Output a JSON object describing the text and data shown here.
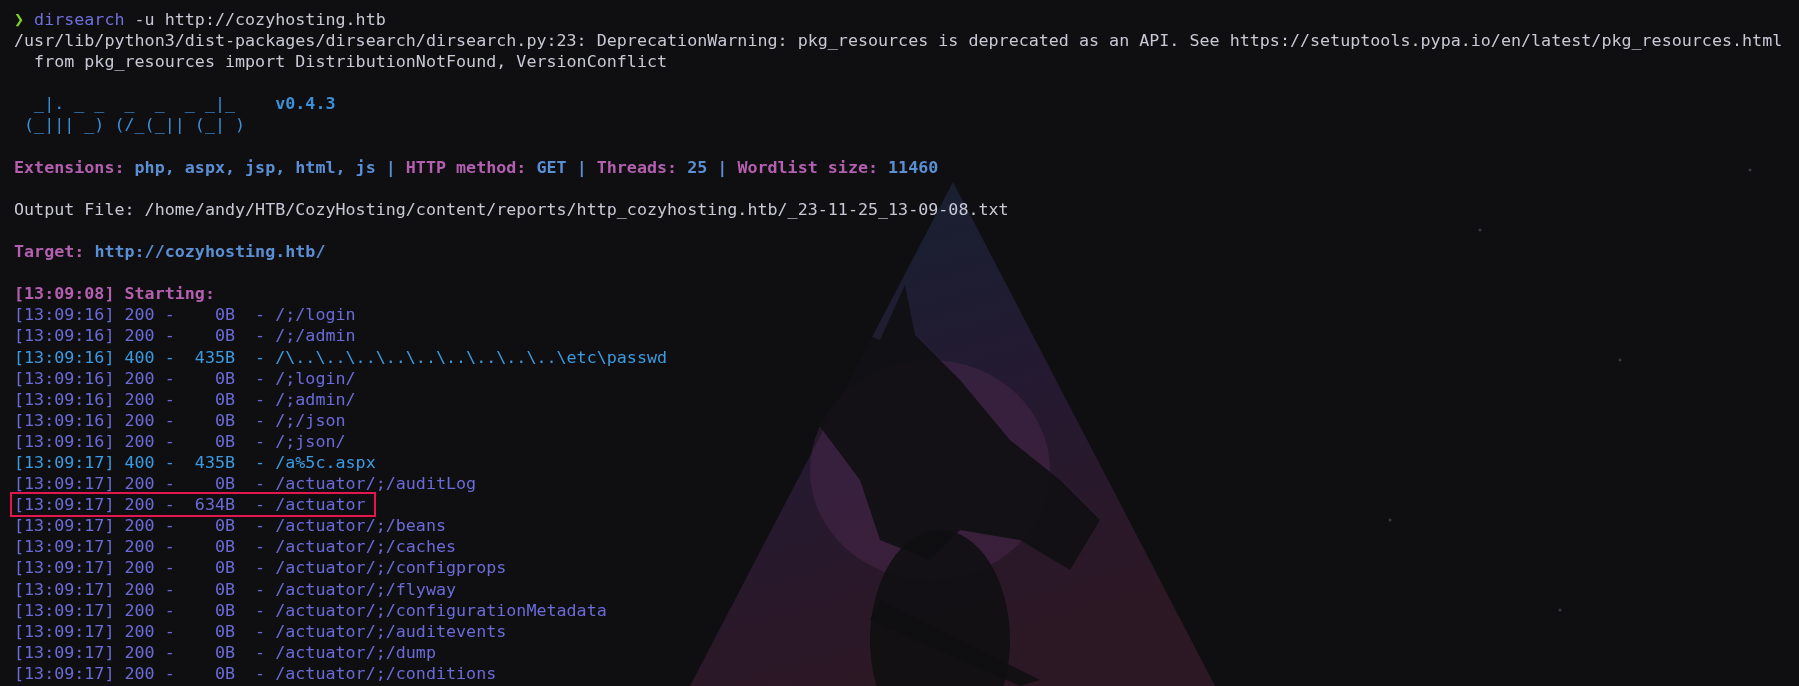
{
  "prompt": {
    "symbol": "❯",
    "command": "dirsearch",
    "arguments": "-u http://cozyhosting.htb"
  },
  "warning": [
    "/usr/lib/python3/dist-packages/dirsearch/dirsearch.py:23: DeprecationWarning: pkg_resources is deprecated as an API. See https://setuptools.pypa.io/en/latest/pkg_resources.html",
    "  from pkg_resources import DistributionNotFound, VersionConflict"
  ],
  "banner": {
    "art": [
      "  _|. _ _  _  _  _ _|_",
      " (_||| _) (/_(_|| (_| )"
    ],
    "version": "v0.4.3"
  },
  "settings": [
    {
      "label": "Extensions:",
      "value": "php, aspx, jsp, html, js",
      "separator": "|"
    },
    {
      "label": "HTTP method:",
      "value": "GET",
      "separator": "|"
    },
    {
      "label": "Threads:",
      "value": "25",
      "separator": "|"
    },
    {
      "label": "Wordlist size:",
      "value": "11460"
    }
  ],
  "output_file": "Output File: /home/andy/HTB/CozyHosting/content/reports/http_cozyhosting.htb/_23-11-25_13-09-08.txt",
  "target": {
    "label": "Target:",
    "value": "http://cozyhosting.htb/"
  },
  "start": "[13:09:08] Starting:",
  "results": [
    {
      "text": "[13:09:16] 200 -    0B  - /;/login",
      "color": "#6b6bd8",
      "highlighted": false
    },
    {
      "text": "[13:09:16] 200 -    0B  - /;/admin",
      "color": "#6b6bd8",
      "highlighted": false
    },
    {
      "text": "[13:09:16] 400 -  435B  - /\\..\\..\\..\\..\\..\\..\\..\\..\\..\\etc\\passwd",
      "color": "#3b9be0",
      "highlighted": false
    },
    {
      "text": "[13:09:16] 200 -    0B  - /;login/",
      "color": "#6b6bd8",
      "highlighted": false
    },
    {
      "text": "[13:09:16] 200 -    0B  - /;admin/",
      "color": "#6b6bd8",
      "highlighted": false
    },
    {
      "text": "[13:09:16] 200 -    0B  - /;/json",
      "color": "#6b6bd8",
      "highlighted": false
    },
    {
      "text": "[13:09:16] 200 -    0B  - /;json/",
      "color": "#6b6bd8",
      "highlighted": false
    },
    {
      "text": "[13:09:17] 400 -  435B  - /a%5c.aspx",
      "color": "#3b9be0",
      "highlighted": false
    },
    {
      "text": "[13:09:17] 200 -    0B  - /actuator/;/auditLog",
      "color": "#6b6bd8",
      "highlighted": false
    },
    {
      "text": "[13:09:17] 200 -  634B  - /actuator",
      "color": "#6b6bd8",
      "highlighted": true
    },
    {
      "text": "[13:09:17] 200 -    0B  - /actuator/;/beans",
      "color": "#6b6bd8",
      "highlighted": false
    },
    {
      "text": "[13:09:17] 200 -    0B  - /actuator/;/caches",
      "color": "#6b6bd8",
      "highlighted": false
    },
    {
      "text": "[13:09:17] 200 -    0B  - /actuator/;/configprops",
      "color": "#6b6bd8",
      "highlighted": false
    },
    {
      "text": "[13:09:17] 200 -    0B  - /actuator/;/flyway",
      "color": "#6b6bd8",
      "highlighted": false
    },
    {
      "text": "[13:09:17] 200 -    0B  - /actuator/;/configurationMetadata",
      "color": "#6b6bd8",
      "highlighted": false
    },
    {
      "text": "[13:09:17] 200 -    0B  - /actuator/;/auditevents",
      "color": "#6b6bd8",
      "highlighted": false
    },
    {
      "text": "[13:09:17] 200 -    0B  - /actuator/;/dump",
      "color": "#6b6bd8",
      "highlighted": false
    },
    {
      "text": "[13:09:17] 200 -    0B  - /actuator/;/conditions",
      "color": "#6b6bd8",
      "highlighted": false
    }
  ]
}
